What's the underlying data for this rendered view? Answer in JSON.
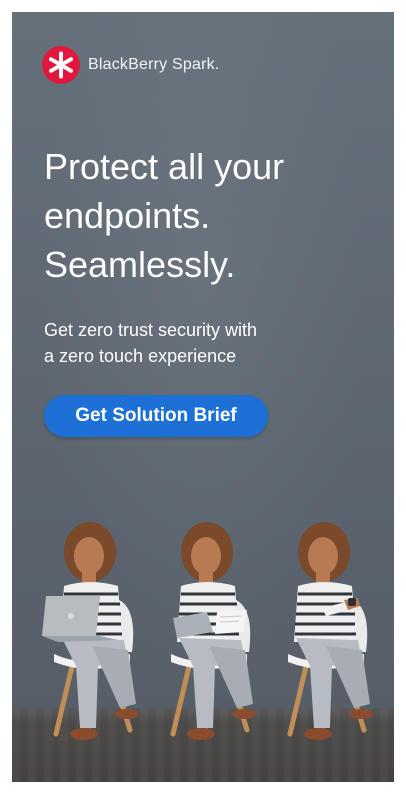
{
  "brand": {
    "name": "BlackBerry Spark.",
    "icon": "blackberry-spark-logo-icon",
    "accent_color": "#E1173F"
  },
  "headline": {
    "line1": "Protect all your",
    "line2": "endpoints.",
    "line3": "Seamlessly."
  },
  "subhead": {
    "line1": "Get zero trust security with",
    "line2": "a zero touch experience"
  },
  "cta": {
    "label": "Get Solution Brief",
    "color": "#1D71D6"
  },
  "photo": {
    "people": [
      {
        "device": "laptop"
      },
      {
        "device": "tablet"
      },
      {
        "device": "smartwatch"
      }
    ]
  }
}
